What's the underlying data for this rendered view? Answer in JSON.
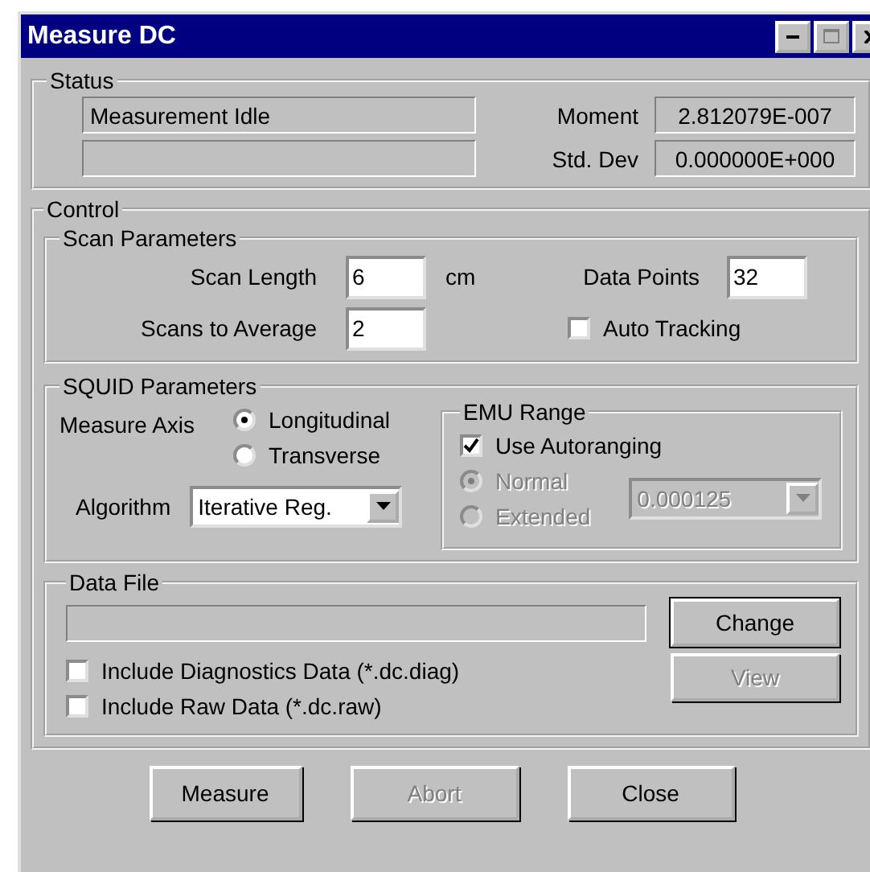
{
  "window": {
    "title": "Measure DC"
  },
  "status": {
    "label": "Status",
    "message": "Measurement Idle",
    "moment_label": "Moment",
    "moment": "2.812079E-007",
    "std_dev_label": "Std. Dev",
    "std_dev": "0.000000E+000"
  },
  "control": {
    "label": "Control",
    "scan_parameters": {
      "label": "Scan Parameters",
      "scan_length": {
        "label": "Scan Length",
        "value": "6",
        "unit": "cm"
      },
      "data_points": {
        "label": "Data Points",
        "value": "32"
      },
      "scans_to_average": {
        "label": "Scans to Average",
        "value": "2"
      },
      "auto_tracking": {
        "label": "Auto Tracking",
        "checked": false
      }
    },
    "squid_parameters": {
      "label": "SQUID Parameters",
      "measure_axis": {
        "label": "Measure Axis",
        "options": [
          {
            "label": "Longitudinal",
            "selected": true
          },
          {
            "label": "Transverse",
            "selected": false
          }
        ]
      },
      "algorithm": {
        "label": "Algorithm",
        "value": "Iterative Reg."
      },
      "emu_range": {
        "label": "EMU Range",
        "use_autoranging": {
          "label": "Use Autoranging",
          "checked": true
        },
        "options": [
          {
            "label": "Normal",
            "selected": true,
            "disabled": true
          },
          {
            "label": "Extended",
            "selected": false,
            "disabled": true
          }
        ],
        "range": {
          "value": "0.000125",
          "disabled": true
        }
      }
    },
    "data_file": {
      "label": "Data File",
      "change_button": {
        "label": "Change",
        "disabled": false
      },
      "view_button": {
        "label": "View",
        "disabled": true
      },
      "options": [
        {
          "label": "Include Diagnostics Data (*.dc.diag)",
          "checked": false
        },
        {
          "label": "Include Raw Data (*.dc.raw)",
          "checked": false
        }
      ]
    }
  },
  "buttons": [
    {
      "label": "Measure",
      "disabled": false
    },
    {
      "label": "Abort",
      "disabled": true
    },
    {
      "label": "Close",
      "disabled": false
    }
  ]
}
